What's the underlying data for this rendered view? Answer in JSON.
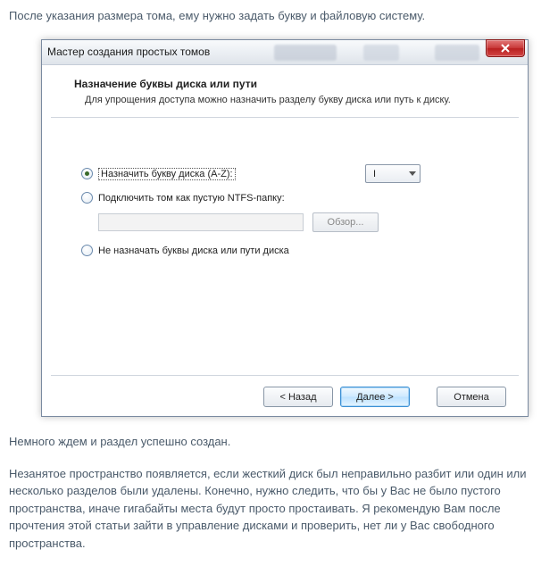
{
  "article": {
    "intro": "После указания размера тома, ему нужно задать букву и файловую систему.",
    "outro1": "Немного ждем и раздел успешно создан.",
    "outro2": "Незанятое пространство появляется, если жесткий диск был неправильно разбит или один или несколько разделов были удалены. Конечно, нужно следить, что бы у Вас не было пустого пространства, иначе гигабайты места будут просто простаивать. Я рекомендую Вам после прочтения этой статьи зайти в управление дисками и проверить, нет ли у Вас свободного пространства."
  },
  "dialog": {
    "title": "Мастер создания простых томов",
    "header": {
      "title": "Назначение буквы диска или пути",
      "subtitle": "Для упрощения доступа можно назначить разделу букву диска или путь к диску."
    },
    "options": {
      "assign_letter": "Назначить букву диска (A-Z):",
      "drive_letter": "I",
      "mount_folder": "Подключить том как пустую NTFS-папку:",
      "browse": "Обзор...",
      "no_assign": "Не назначать буквы диска или пути диска"
    },
    "buttons": {
      "back": "< Назад",
      "next": "Далее >",
      "cancel": "Отмена"
    }
  }
}
